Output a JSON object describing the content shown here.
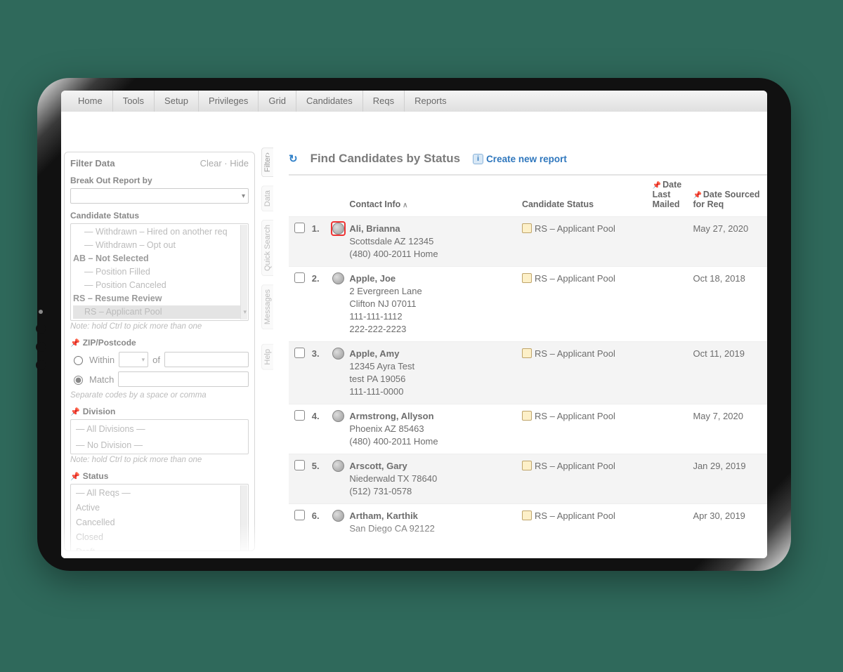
{
  "menu": [
    "Home",
    "Tools",
    "Setup",
    "Privileges",
    "Grid",
    "Candidates",
    "Reqs",
    "Reports"
  ],
  "sideTabs": [
    "Filter›",
    "Data",
    "Quick Search",
    "Messages",
    "Help"
  ],
  "filter": {
    "title": "Filter Data",
    "clear": "Clear",
    "hide": "Hide",
    "breakout_label": "Break Out Report by",
    "cand_status_label": "Candidate Status",
    "cand_status_list": [
      "— Withdrawn – Hired on another req",
      "— Withdrawn – Opt out",
      "AB – Not Selected",
      "— Position Filled",
      "— Position Canceled",
      "RS – Resume Review",
      "RS – Applicant Pool"
    ],
    "cand_status_bold": [
      2,
      5
    ],
    "cand_status_selected": 6,
    "note_ctrl": "Note: hold Ctrl to pick more than one",
    "zip_label": "ZIP/Postcode",
    "within_label": "Within",
    "of_label": "of",
    "match_label": "Match",
    "zip_note": "Separate codes by a space or comma",
    "division_label": "Division",
    "division_list": [
      "— All Divisions —",
      "— No Division —"
    ],
    "status_label": "Status",
    "status_list": [
      "— All Reqs —",
      "Active",
      "Cancelled",
      "Closed",
      "Draft"
    ]
  },
  "main": {
    "title": "Find Candidates by Status",
    "report_link": "Create new report",
    "columns": {
      "contact": "Contact Info",
      "status": "Candidate Status",
      "mailed": "Date Last Mailed",
      "sourced": "Date Sourced for Req"
    },
    "rows": [
      {
        "num": "1.",
        "name": "Ali, Brianna",
        "lines": [
          "Scottsdale AZ 12345",
          "(480) 400-2011 Home"
        ],
        "status": "RS – Applicant Pool",
        "sourced": "May 27, 2020",
        "alt": true,
        "highlightGear": true
      },
      {
        "num": "2.",
        "name": "Apple, Joe",
        "lines": [
          "2 Evergreen Lane",
          "Clifton NJ 07011",
          "111-111-1112",
          "222-222-2223"
        ],
        "status": "RS – Applicant Pool",
        "sourced": "Oct 18, 2018",
        "alt": false
      },
      {
        "num": "3.",
        "name": "Apple, Amy",
        "lines": [
          "12345 Ayra Test",
          "test PA 19056",
          "111-111-0000"
        ],
        "status": "RS – Applicant Pool",
        "sourced": "Oct 11, 2019",
        "alt": true
      },
      {
        "num": "4.",
        "name": "Armstrong, Allyson",
        "lines": [
          "Phoenix AZ 85463",
          "(480) 400-2011 Home"
        ],
        "status": "RS – Applicant Pool",
        "sourced": "May 7, 2020",
        "alt": false
      },
      {
        "num": "5.",
        "name": "Arscott, Gary",
        "lines": [
          "Niederwald TX 78640",
          "(512) 731-0578"
        ],
        "status": "RS – Applicant Pool",
        "sourced": "Jan 29, 2019",
        "alt": true
      },
      {
        "num": "6.",
        "name": "Artham, Karthik",
        "lines": [
          "San Diego CA 92122"
        ],
        "status": "RS – Applicant Pool",
        "sourced": "Apr 30, 2019",
        "alt": false
      }
    ]
  }
}
